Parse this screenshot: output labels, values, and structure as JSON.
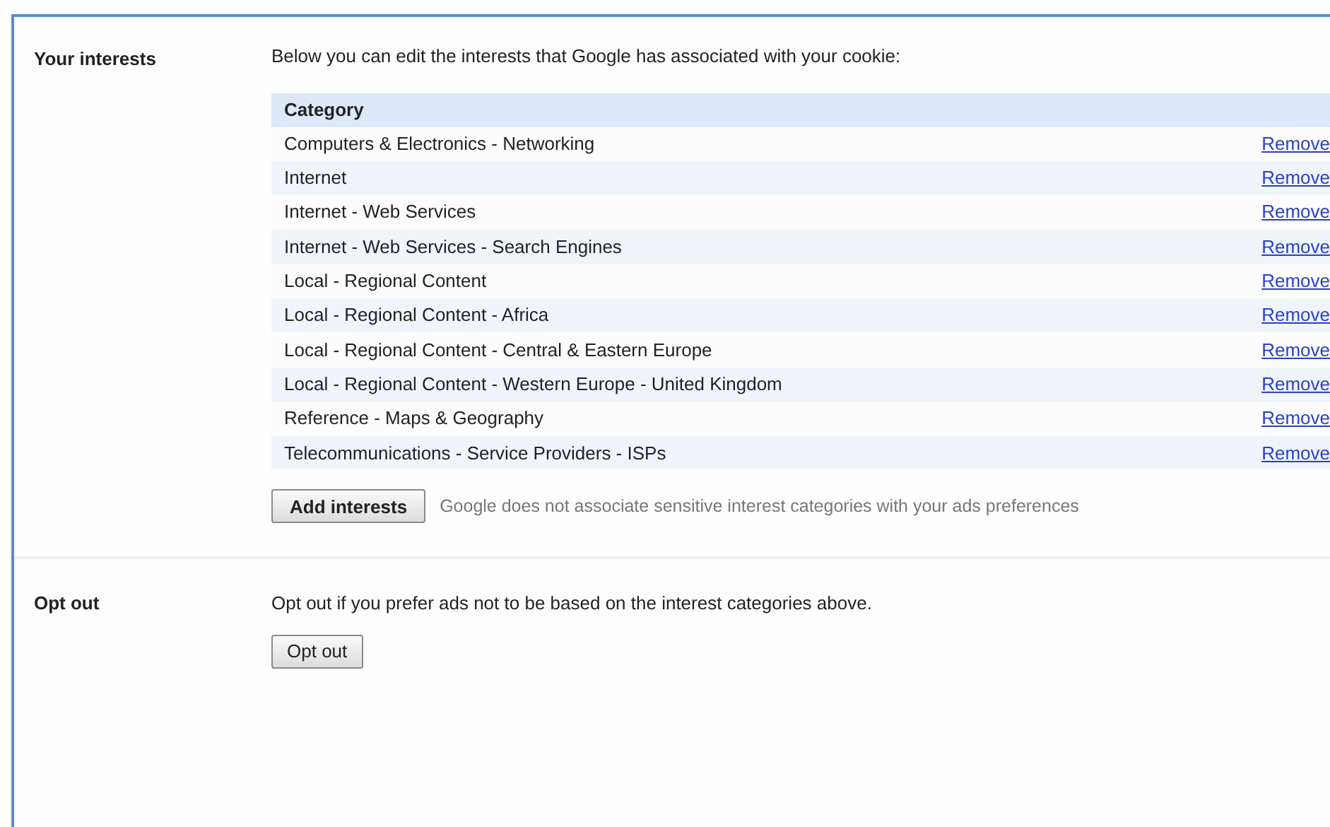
{
  "sections": [
    {
      "kind": "interests",
      "label": "Your interests",
      "intro": "Below you can edit the interests that Google has associated with your cookie:",
      "table": {
        "columns": [
          "Category"
        ],
        "rows": [
          {
            "category": "Computers & Electronics - Networking",
            "action": "Remove"
          },
          {
            "category": "Internet",
            "action": "Remove"
          },
          {
            "category": "Internet - Web Services",
            "action": "Remove"
          },
          {
            "category": "Internet - Web Services - Search Engines",
            "action": "Remove"
          },
          {
            "category": "Local - Regional Content",
            "action": "Remove"
          },
          {
            "category": "Local - Regional Content - Africa",
            "action": "Remove"
          },
          {
            "category": "Local - Regional Content - Central & Eastern Europe",
            "action": "Remove"
          },
          {
            "category": "Local - Regional Content - Western Europe - United Kingdom",
            "action": "Remove"
          },
          {
            "category": "Reference - Maps & Geography",
            "action": "Remove"
          },
          {
            "category": "Telecommunications - Service Providers - ISPs",
            "action": "Remove"
          }
        ]
      },
      "button": "Add interests",
      "note": "Google does not associate sensitive interest categories with your ads preferences"
    },
    {
      "kind": "optout",
      "label": "Opt out",
      "intro": "Opt out if you prefer ads not to be based on the interest categories above.",
      "button": "Opt out"
    }
  ]
}
